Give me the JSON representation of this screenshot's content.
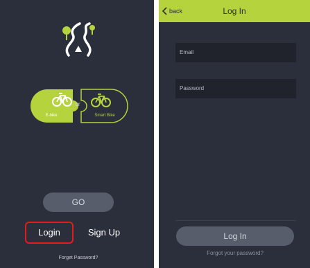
{
  "left_screen": {
    "bike_options": [
      {
        "label": "E-bike",
        "selected": true
      },
      {
        "label": "Smart Bike",
        "selected": false
      }
    ],
    "or_label": "or",
    "go_label": "GO",
    "login_label": "Login",
    "signup_label": "Sign Up",
    "forgot_label": "Forget Password?"
  },
  "right_screen": {
    "back_label": "back",
    "title": "Log In",
    "email_placeholder": "Email",
    "password_placeholder": "Password",
    "login_label": "Log In",
    "forgot_label": "Forgot your password?"
  },
  "colors": {
    "background": "#2b2f3b",
    "accent": "#b5d33c",
    "highlight": "#e31d1d",
    "button": "#575d6b",
    "field": "#20232c"
  },
  "icons": [
    "route-logo-icon",
    "ebike-icon",
    "smart-bike-icon",
    "chevron-left-icon"
  ]
}
